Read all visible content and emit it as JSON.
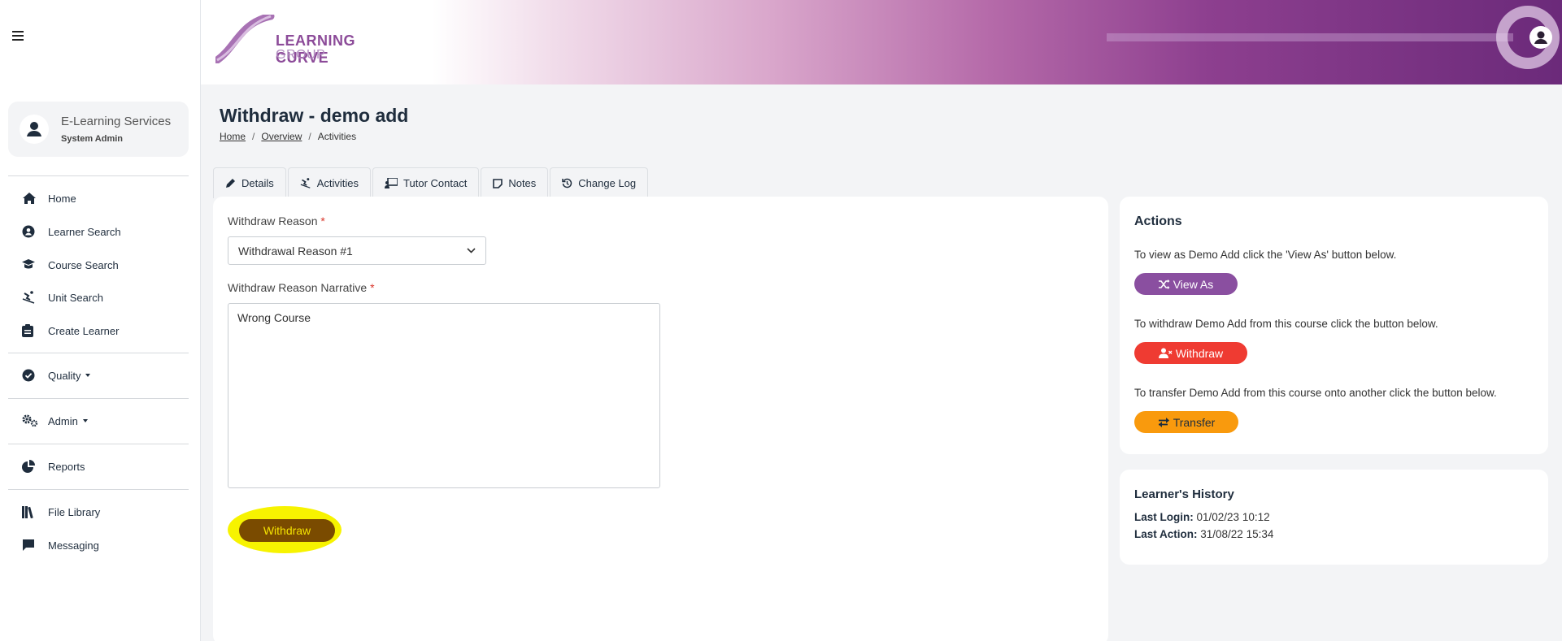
{
  "header": {
    "logo_line1": "LEARNING CURVE",
    "logo_line2": "GROUP"
  },
  "sidebar": {
    "user": {
      "name": "E-Learning Services",
      "role": "System Admin"
    },
    "items": [
      {
        "label": "Home",
        "icon": "home-icon"
      },
      {
        "label": "Learner Search",
        "icon": "user-circle-icon"
      },
      {
        "label": "Course Search",
        "icon": "graduation-cap-icon"
      },
      {
        "label": "Unit Search",
        "icon": "skiing-icon"
      },
      {
        "label": "Create Learner",
        "icon": "clipboard-icon"
      },
      {
        "label": "Quality",
        "icon": "check-circle-icon"
      },
      {
        "label": "Admin",
        "icon": "gears-icon"
      },
      {
        "label": "Reports",
        "icon": "pie-chart-icon"
      },
      {
        "label": "File Library",
        "icon": "books-icon"
      },
      {
        "label": "Messaging",
        "icon": "message-icon"
      }
    ]
  },
  "page": {
    "title": "Withdraw - demo add",
    "breadcrumb": {
      "home": "Home",
      "overview": "Overview",
      "current": "Activities",
      "separator": "/"
    }
  },
  "tabs": [
    {
      "label": "Details",
      "icon": "pencil-icon"
    },
    {
      "label": "Activities",
      "icon": "skiing-icon"
    },
    {
      "label": "Tutor Contact",
      "icon": "chalkboard-user-icon"
    },
    {
      "label": "Notes",
      "icon": "note-icon"
    },
    {
      "label": "Change Log",
      "icon": "history-icon"
    }
  ],
  "form": {
    "reason_label": "Withdraw Reason",
    "reason_value": "Withdrawal Reason #1",
    "narrative_label": "Withdraw Reason Narrative",
    "narrative_value": "Wrong Course",
    "required_mark": "*",
    "submit_label": "Withdraw"
  },
  "actions": {
    "title": "Actions",
    "view_as_text": "To view as Demo Add click the 'View As' button below.",
    "view_as_label": "View As",
    "withdraw_text": "To withdraw Demo Add from this course click the button below.",
    "withdraw_label": "Withdraw",
    "transfer_text": "To transfer Demo Add from this course onto another click the button below.",
    "transfer_label": "Transfer"
  },
  "history": {
    "title": "Learner's History",
    "last_login_label": "Last Login:",
    "last_login_value": "01/02/23 10:12",
    "last_action_label": "Last Action:",
    "last_action_value": "31/08/22 15:34"
  },
  "colors": {
    "view_as": "#8a4fa0",
    "withdraw": "#ef3b32",
    "transfer": "#f99a0d",
    "submit_bg": "#7a4b00",
    "highlight": "#f7f300"
  }
}
